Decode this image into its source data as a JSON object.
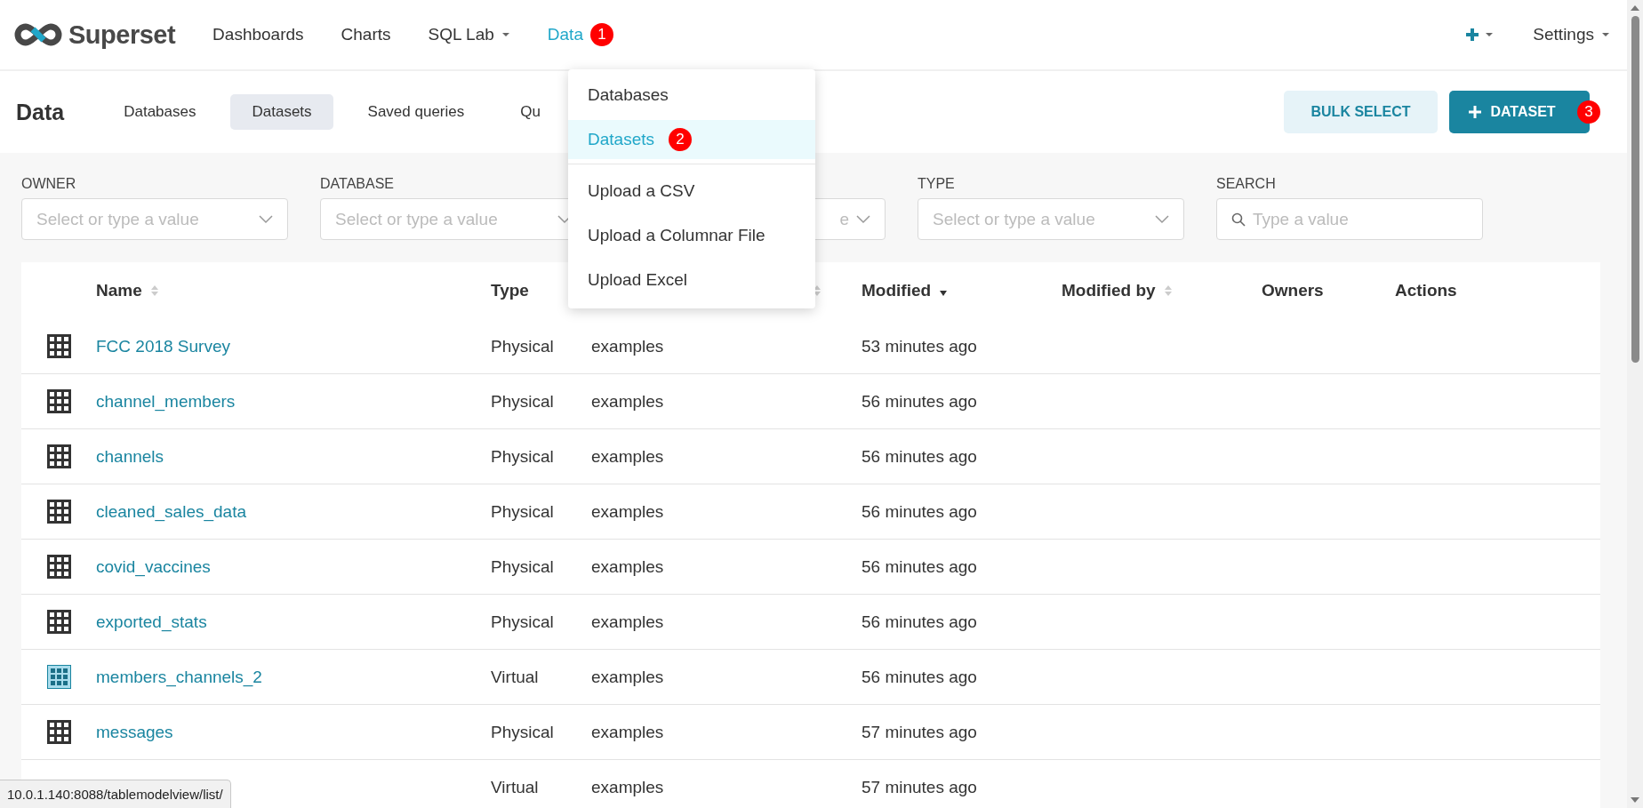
{
  "header": {
    "logo": "Superset",
    "nav": [
      {
        "label": "Dashboards",
        "selected": false,
        "caret": false
      },
      {
        "label": "Charts",
        "selected": false,
        "caret": false
      },
      {
        "label": "SQL Lab",
        "selected": false,
        "caret": true
      },
      {
        "label": "Data",
        "selected": true,
        "caret": false,
        "badge": "1"
      }
    ],
    "settings": "Settings"
  },
  "page": {
    "title": "Data",
    "tabs": [
      {
        "label": "Databases",
        "selected": false
      },
      {
        "label": "Datasets",
        "selected": true
      },
      {
        "label": "Saved queries",
        "selected": false
      },
      {
        "label": "Qu",
        "selected": false
      }
    ],
    "buttons": [
      {
        "label": "BULK SELECT",
        "kind": "secondary"
      },
      {
        "label": "DATASET",
        "kind": "primary",
        "badge": "3"
      }
    ]
  },
  "filters": [
    {
      "label": "OWNER",
      "placeholder": "Select or type a value",
      "kind": "select"
    },
    {
      "label": "DATABASE",
      "placeholder": "Select or type a value",
      "kind": "select"
    },
    {
      "placeholder": "e",
      "kind": "select"
    },
    {
      "label": "TYPE",
      "placeholder": "Select or type a value",
      "kind": "select"
    },
    {
      "label": "SEARCH",
      "placeholder": "Type a value",
      "kind": "search"
    }
  ],
  "table": {
    "columns": [
      {
        "label": "Name",
        "sortable": true,
        "sorted": false
      },
      {
        "label": "Type",
        "sortable": false
      },
      {
        "sortable": true,
        "sorted": false
      },
      {
        "label": "Modified",
        "sortable": true,
        "sorted": true
      },
      {
        "label": "Modified by",
        "sortable": true,
        "sorted": false
      },
      {
        "label": "Owners",
        "sortable": false
      },
      {
        "label": "Actions",
        "sortable": false
      }
    ],
    "rows": [
      {
        "kind": "physical",
        "name": "FCC 2018 Survey",
        "type": "Physical",
        "database": "examples",
        "modified": "53 minutes ago"
      },
      {
        "kind": "physical",
        "name": "channel_members",
        "type": "Physical",
        "database": "examples",
        "modified": "56 minutes ago"
      },
      {
        "kind": "physical",
        "name": "channels",
        "type": "Physical",
        "database": "examples",
        "modified": "56 minutes ago"
      },
      {
        "kind": "physical",
        "name": "cleaned_sales_data",
        "type": "Physical",
        "database": "examples",
        "modified": "56 minutes ago"
      },
      {
        "kind": "physical",
        "name": "covid_vaccines",
        "type": "Physical",
        "database": "examples",
        "modified": "56 minutes ago"
      },
      {
        "kind": "physical",
        "name": "exported_stats",
        "type": "Physical",
        "database": "examples",
        "modified": "56 minutes ago"
      },
      {
        "kind": "virtual",
        "name": "members_channels_2",
        "type": "Virtual",
        "database": "examples",
        "modified": "56 minutes ago"
      },
      {
        "kind": "physical",
        "name": "messages",
        "type": "Physical",
        "database": "examples",
        "modified": "57 minutes ago"
      },
      {
        "type": "Virtual",
        "database": "examples",
        "modified": "57 minutes ago"
      }
    ]
  },
  "menu": {
    "sections": [
      [
        {
          "label": "Databases",
          "selected": false
        },
        {
          "label": "Datasets",
          "selected": true,
          "badge": "2"
        }
      ],
      [
        {
          "label": "Upload a CSV",
          "selected": false
        },
        {
          "label": "Upload a Columnar File",
          "selected": false
        },
        {
          "label": "Upload Excel",
          "selected": false
        }
      ]
    ]
  },
  "status_url": "10.0.1.140:8088/tablemodelview/list/"
}
